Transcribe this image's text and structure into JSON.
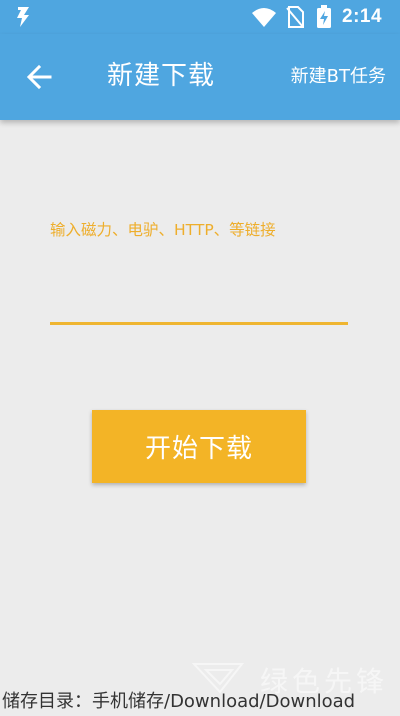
{
  "status_bar": {
    "time": "2:14",
    "icons": [
      "app-bolt-icon",
      "wifi-icon",
      "no-sim-icon",
      "battery-charging-icon"
    ]
  },
  "toolbar": {
    "title": "新建下载",
    "bt_action": "新建BT任务",
    "back_icon": "arrow-left-icon"
  },
  "link_field": {
    "hint": "输入磁力、电驴、HTTP、等链接",
    "value": ""
  },
  "start_button": {
    "label": "开始下载"
  },
  "footer": {
    "storage_path": "储存目录：手机储存/Download/Download"
  },
  "watermark": {
    "text": "绿色先锋"
  },
  "colors": {
    "primary": "#4fa6e0",
    "accent": "#f3b426",
    "hint": "#eeae2c",
    "background": "#ececec"
  }
}
